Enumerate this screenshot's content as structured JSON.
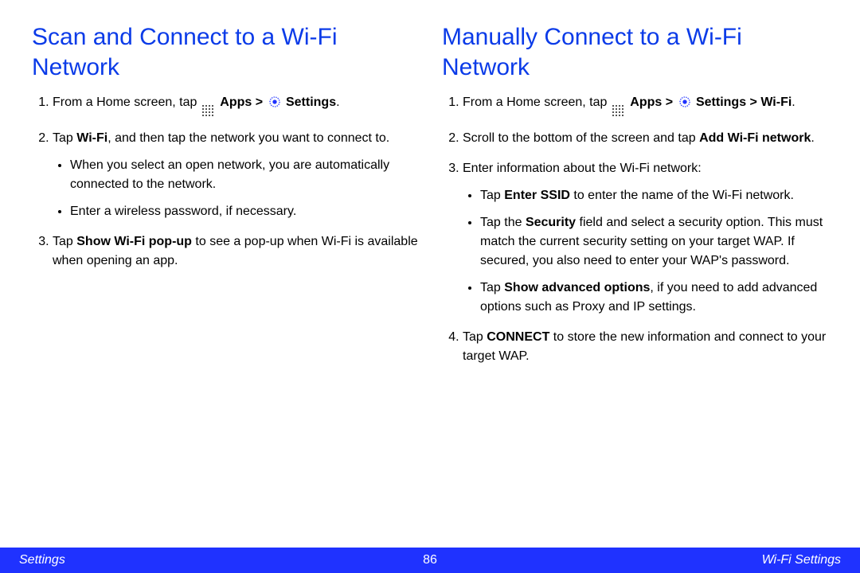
{
  "left": {
    "heading": "Scan and Connect to a Wi-Fi Network",
    "step1_a": "From a Home screen, tap ",
    "apps": "Apps > ",
    "settings": "Settings",
    "step1_end": ".",
    "step2_a": "Tap ",
    "step2_b": "Wi-Fi",
    "step2_c": ", and then tap the network you want to connect to.",
    "bullet1": "When you select an open network, you are automatically connected to the network.",
    "bullet2": "Enter a wireless password, if necessary.",
    "step3_a": "Tap ",
    "step3_b": "Show Wi-Fi pop-up",
    "step3_c": " to see a pop-up when Wi-Fi is available when opening an app."
  },
  "right": {
    "heading": "Manually Connect to a Wi-Fi Network",
    "step1_a": "From a Home screen, tap ",
    "apps": "Apps > ",
    "settings": "Settings > Wi-Fi",
    "step1_end": ".",
    "step2_a": "Scroll to the bottom of the screen and tap ",
    "step2_b": "Add Wi-Fi network",
    "step2_c": ".",
    "step3": "Enter information about the Wi-Fi network:",
    "b1_a": "Tap ",
    "b1_b": "Enter SSID",
    "b1_c": " to enter the name of the Wi-Fi network.",
    "b2_a": "Tap the ",
    "b2_b": "Security",
    "b2_c": " field and select a security option. This must match the current security setting on your target WAP. If secured, you also need to enter your WAP's password.",
    "b3_a": "Tap ",
    "b3_b": "Show advanced options",
    "b3_c": ", if you need to add advanced options such as Proxy and IP settings.",
    "step4_a": "Tap ",
    "step4_b": "CONNECT",
    "step4_c": " to store the new information and connect to your target WAP."
  },
  "footer": {
    "left": "Settings",
    "center": "86",
    "right": "Wi-Fi Settings"
  }
}
